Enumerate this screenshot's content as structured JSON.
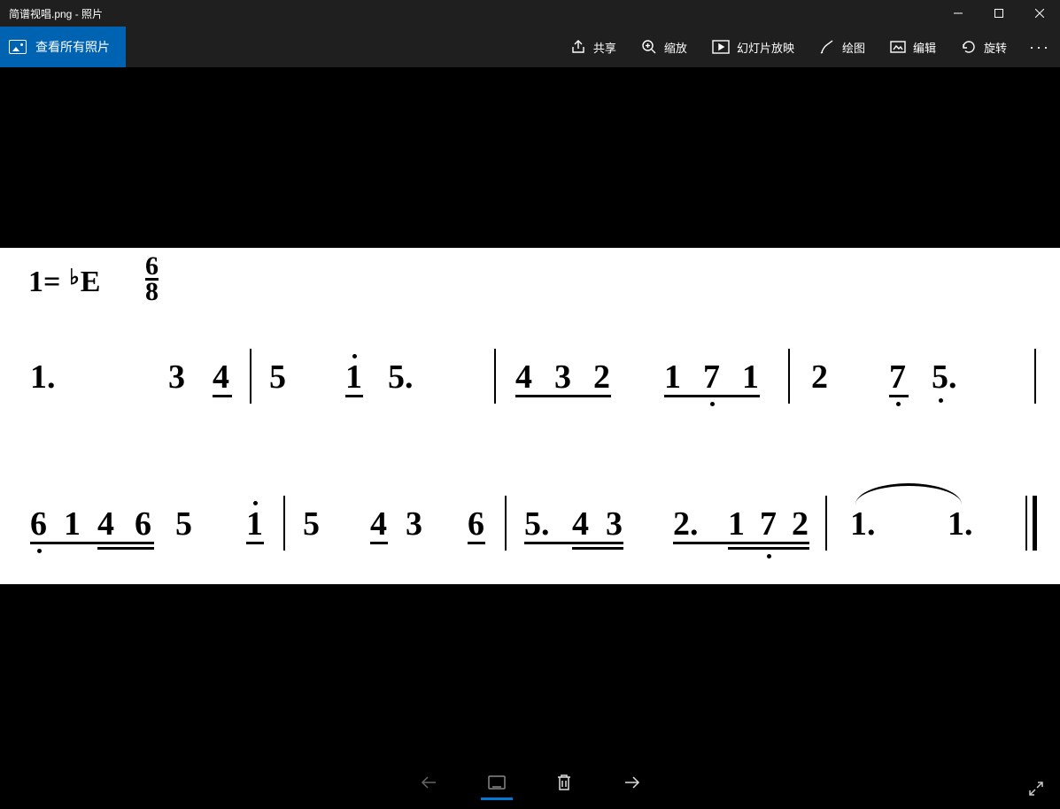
{
  "window": {
    "title": "简谱视唱.png - 照片"
  },
  "toolbar": {
    "view_all": "查看所有照片",
    "share": "共享",
    "zoom": "缩放",
    "slideshow": "幻灯片放映",
    "draw": "绘图",
    "edit": "编辑",
    "rotate": "旋转"
  },
  "music": {
    "key_prefix": "1=",
    "key_letter": "E",
    "time_num": "6",
    "time_den": "8",
    "line1": {
      "bar1": [
        "1.",
        "3",
        "4"
      ],
      "bar2": [
        "5",
        "1",
        "5."
      ],
      "bar3": [
        "4",
        "3",
        "2",
        "1",
        "7",
        "1"
      ],
      "bar4": [
        "2",
        "7",
        "5."
      ]
    },
    "line2": {
      "bar1": [
        "6",
        "1",
        "4",
        "6",
        "5",
        "1"
      ],
      "bar2": [
        "5",
        "4",
        "3",
        "6"
      ],
      "bar3": [
        "5.",
        "4",
        "3",
        "2.",
        "1",
        "7",
        "2"
      ],
      "bar4": [
        "1.",
        "1."
      ]
    }
  }
}
